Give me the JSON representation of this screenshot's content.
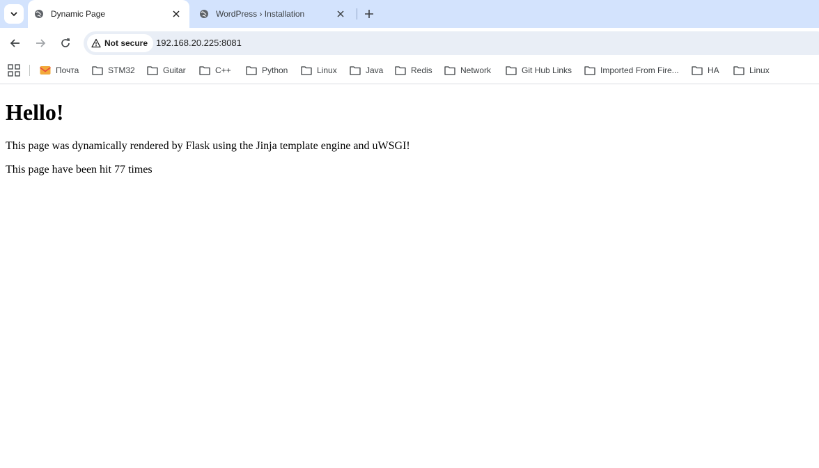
{
  "tabs": [
    {
      "title": "Dynamic Page",
      "active": true,
      "favicon": "globe-icon"
    },
    {
      "title": "WordPress › Installation",
      "active": false,
      "favicon": "globe-icon"
    }
  ],
  "toolbar": {
    "security_label": "Not secure",
    "url": "192.168.20.225:8081"
  },
  "bookmarks": [
    {
      "label": "Почта",
      "icon": "mail-icon"
    },
    {
      "label": "STM32",
      "icon": "folder-icon"
    },
    {
      "label": "Guitar",
      "icon": "folder-icon"
    },
    {
      "label": "C++",
      "icon": "folder-icon"
    },
    {
      "label": "Python",
      "icon": "folder-icon"
    },
    {
      "label": "Linux",
      "icon": "folder-icon"
    },
    {
      "label": "Java",
      "icon": "folder-icon"
    },
    {
      "label": "Redis",
      "icon": "folder-icon"
    },
    {
      "label": "Network",
      "icon": "folder-icon"
    },
    {
      "label": "Git Hub Links",
      "icon": "folder-icon"
    },
    {
      "label": "Imported From Fire...",
      "icon": "folder-icon"
    },
    {
      "label": "HA",
      "icon": "folder-icon"
    },
    {
      "label": "Linux",
      "icon": "folder-icon"
    }
  ],
  "page": {
    "heading": "Hello!",
    "line1": "This page was dynamically rendered by Flask using the Jinja template engine and uWSGI!",
    "line2": "This page have been hit 77 times"
  },
  "colors": {
    "tabstrip_bg": "#d3e3fd",
    "omnibox_bg": "#e9eef6",
    "mail_icon": "#f2a93b"
  }
}
